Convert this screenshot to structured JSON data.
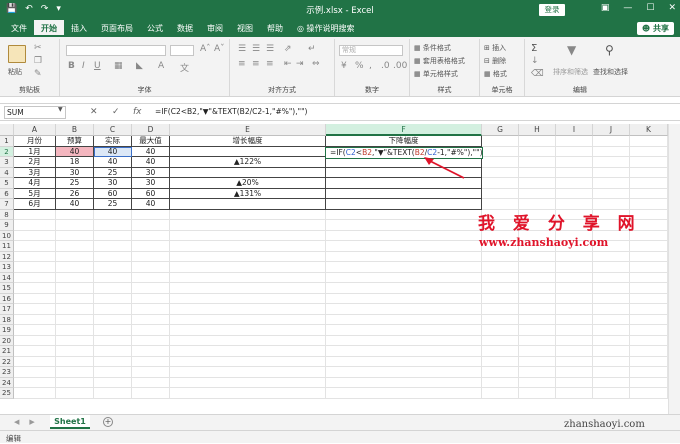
{
  "window": {
    "title": "示例.xlsx - Excel",
    "login_label": "登录",
    "qa_icons": [
      "save-icon",
      "undo-icon",
      "redo-icon"
    ],
    "window_controls": [
      "ribbon-display-icon",
      "minimize-icon",
      "restore-icon",
      "close-icon"
    ]
  },
  "menu": {
    "tabs": [
      "文件",
      "开始",
      "插入",
      "页面布局",
      "公式",
      "数据",
      "审阅",
      "视图",
      "帮助"
    ],
    "active_tab": "开始",
    "search_label": "操作说明搜索",
    "share_label": "共享"
  },
  "ribbon": {
    "clipboard": {
      "paste": "粘贴",
      "label": "剪贴板"
    },
    "font": {
      "label": "字体"
    },
    "alignment": {
      "label": "对齐方式"
    },
    "number": {
      "format_value": "常规",
      "label": "数字"
    },
    "styles": {
      "items": [
        "条件格式",
        "套用表格格式",
        "单元格样式"
      ],
      "label": "样式"
    },
    "cells": {
      "items": [
        "插入",
        "删除",
        "格式"
      ],
      "label": "单元格"
    },
    "editing": {
      "sort_filter": "排序和筛选",
      "find_select": "查找和选择",
      "label": "编辑"
    }
  },
  "formula_bar": {
    "name_box": "SUM",
    "cancel_icon": "✕",
    "enter_icon": "✓",
    "fx_label": "fx",
    "formula": "=IF(C2<B2,\"▼\"&TEXT(B2/C2-1,\"#%\"),\"\")"
  },
  "grid": {
    "columns": [
      "A",
      "B",
      "C",
      "D",
      "E",
      "F",
      "G",
      "H",
      "I",
      "J",
      "K"
    ],
    "selected_column": "F",
    "rows": [
      "1",
      "2",
      "3",
      "4",
      "5",
      "6",
      "7",
      "8",
      "9",
      "10",
      "11",
      "12",
      "13",
      "14",
      "15",
      "16",
      "17",
      "18",
      "19",
      "20",
      "21",
      "22",
      "23",
      "24",
      "25"
    ],
    "selected_row": "2",
    "headers": [
      "月份",
      "预算",
      "实际",
      "最大值",
      "增长幅度",
      "下降幅度"
    ],
    "data": [
      [
        "1月",
        "40",
        "40",
        "40",
        "",
        ""
      ],
      [
        "2月",
        "18",
        "40",
        "40",
        "▲122%",
        ""
      ],
      [
        "3月",
        "30",
        "25",
        "30",
        "",
        ""
      ],
      [
        "4月",
        "25",
        "30",
        "30",
        "▲20%",
        ""
      ],
      [
        "5月",
        "26",
        "60",
        "60",
        "▲131%",
        ""
      ],
      [
        "6月",
        "40",
        "25",
        "40",
        "",
        ""
      ]
    ],
    "active_cell_formula": {
      "p1": "=IF(",
      "c2a": "C2",
      "p2": "<",
      "b2a": "B2",
      "p3": ",\"▼\"&TEXT(",
      "b2b": "B2",
      "p4": "/",
      "c2b": "C2",
      "p5": "-1,\"#%\"),\"\")"
    }
  },
  "watermark": {
    "title": "我 爱 分 享 网",
    "url": "www.zhanshaoyi.com",
    "footer": "zhanshaoyi.com"
  },
  "sheets": {
    "tabs": [
      "Sheet1"
    ],
    "add_icon": "+"
  },
  "status": {
    "mode": "编辑"
  },
  "colors": {
    "accent": "#217346",
    "budget_highlight": "#f4b6bf",
    "actual_highlight": "#dce8f7",
    "watermark": "#e0142a"
  }
}
